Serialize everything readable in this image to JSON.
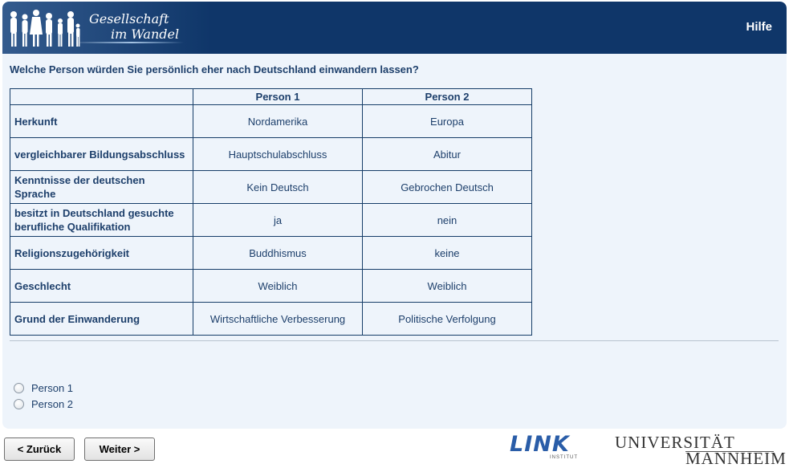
{
  "header": {
    "logo_line1": "Gesellschaft",
    "logo_line2": "im Wandel",
    "help_label": "Hilfe",
    "background_color": "#0f3669"
  },
  "question": "Welche Person würden Sie persönlich eher nach Deutschland einwandern lassen?",
  "table": {
    "columns": [
      "Person 1",
      "Person 2"
    ],
    "rows": [
      {
        "attribute": "Herkunft",
        "p1": "Nordamerika",
        "p2": "Europa"
      },
      {
        "attribute": "vergleichbarer Bildungsabschluss",
        "p1": "Hauptschulabschluss",
        "p2": "Abitur"
      },
      {
        "attribute": "Kenntnisse der deutschen Sprache",
        "p1": "Kein Deutsch",
        "p2": "Gebrochen Deutsch"
      },
      {
        "attribute": "besitzt in Deutschland gesuchte berufliche Qualifikation",
        "p1": "ja",
        "p2": "nein"
      },
      {
        "attribute": "Religionszugehörigkeit",
        "p1": "Buddhismus",
        "p2": "keine"
      },
      {
        "attribute": "Geschlecht",
        "p1": "Weiblich",
        "p2": "Weiblich"
      },
      {
        "attribute": "Grund der Einwanderung",
        "p1": "Wirtschaftliche Verbesserung",
        "p2": "Politische Verfolgung"
      }
    ]
  },
  "options": [
    {
      "label": "Person 1",
      "selected": false
    },
    {
      "label": "Person 2",
      "selected": false
    }
  ],
  "nav": {
    "back_label": "< Zurück",
    "next_label": "Weiter >"
  },
  "footer": {
    "link_logo": "LINK",
    "link_sub": "INSTITUT",
    "uni_line1": "UNIVERSITÄT",
    "uni_line2": "MANNHEIM"
  }
}
